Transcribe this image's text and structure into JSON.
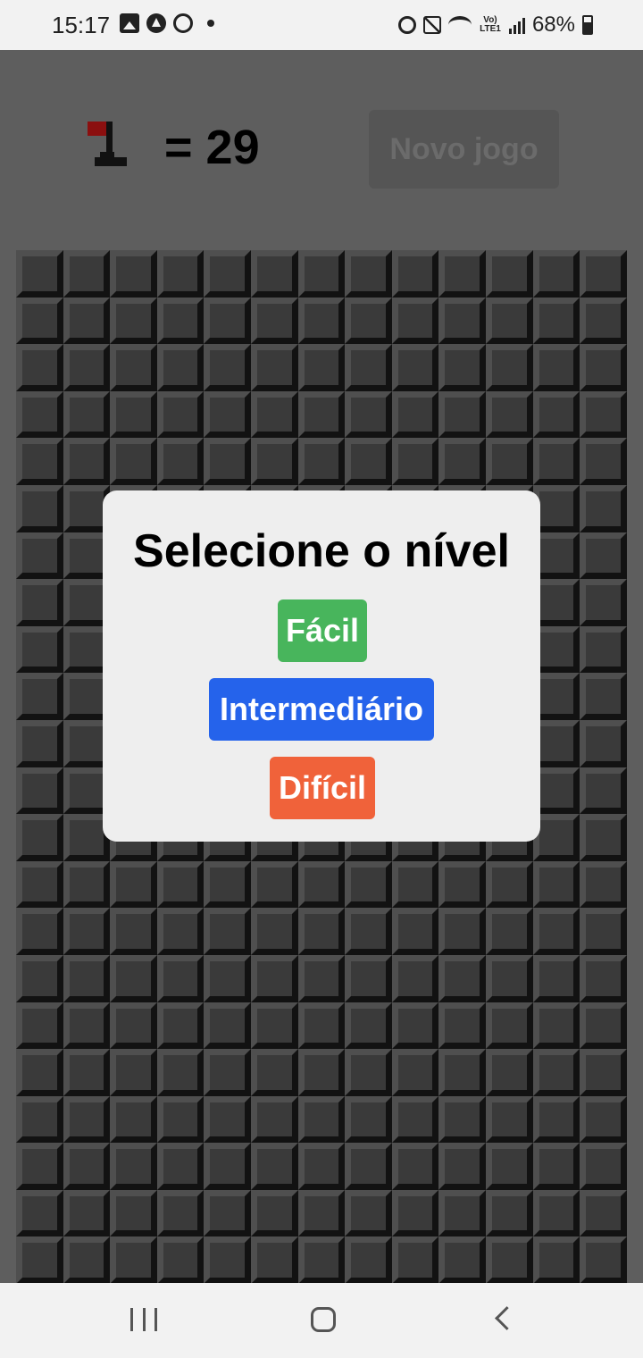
{
  "status_bar": {
    "time": "15:17",
    "network_label": "Vo) LTE1",
    "battery": "68%",
    "left_icons": [
      "gallery-icon",
      "app-icon",
      "whatsapp-icon",
      "dot-icon"
    ],
    "right_icons": [
      "alarm-icon",
      "mute-icon",
      "wifi-icon",
      "signal-icon",
      "battery-icon"
    ]
  },
  "header": {
    "flag_count": "= 29",
    "new_game_label": "Novo jogo"
  },
  "board": {
    "columns": 13,
    "rows": 22
  },
  "modal": {
    "title": "Selecione o nível",
    "levels": [
      {
        "label": "Fácil",
        "color": "#48b55c"
      },
      {
        "label": "Intermediário",
        "color": "#2563eb"
      },
      {
        "label": "Difícil",
        "color": "#f0623a"
      }
    ]
  },
  "nav_bar": {
    "icons": [
      "recents-icon",
      "home-icon",
      "back-icon"
    ]
  }
}
